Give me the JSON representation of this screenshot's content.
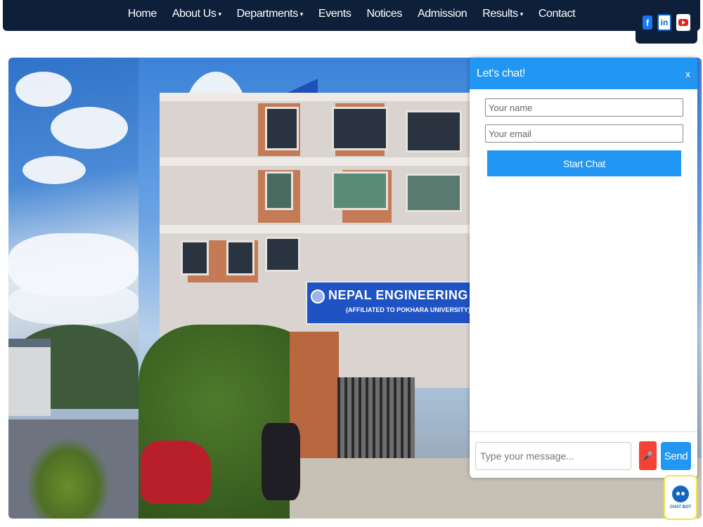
{
  "nav": {
    "items": [
      {
        "label": "Home",
        "caret": ""
      },
      {
        "label": "About Us",
        "caret": "▾"
      },
      {
        "label": "Departments",
        "caret": "▾"
      },
      {
        "label": "Events",
        "caret": ""
      },
      {
        "label": "Notices",
        "caret": ""
      },
      {
        "label": "Admission",
        "caret": ""
      },
      {
        "label": "Results",
        "caret": "▾"
      },
      {
        "label": "Contact",
        "caret": ""
      }
    ],
    "social": {
      "facebook": "f",
      "linkedin": "in"
    }
  },
  "hero": {
    "sign_title": "NEPAL ENGINEERING COL",
    "sign_subtitle": "(AFFILIATED TO POKHARA UNIVERSITY)"
  },
  "chat": {
    "title": "Let's chat!",
    "close": "x",
    "name_placeholder": "Your name",
    "email_placeholder": "Your email",
    "start_label": "Start Chat",
    "message_placeholder": "Type your message...",
    "send_label": "Send",
    "mic_icon": "🎤"
  },
  "chatbot": {
    "label": "CHAT BOT"
  },
  "colors": {
    "nav_bg": "#0e1f3a",
    "accent": "#2196f3",
    "mic": "#f44336"
  }
}
